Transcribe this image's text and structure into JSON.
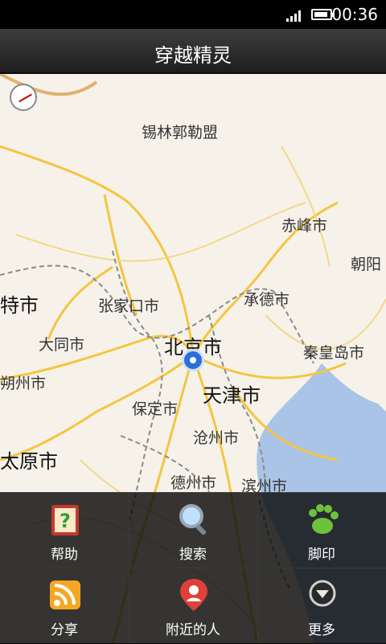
{
  "status_bar": {
    "time": "00:36"
  },
  "app": {
    "title": "穿越精灵"
  },
  "map": {
    "cities": [
      {
        "name": "锡林郭勒盟"
      },
      {
        "name": "赤峰市"
      },
      {
        "name": "朝阳"
      },
      {
        "name": "特市"
      },
      {
        "name": "张家口市"
      },
      {
        "name": "承德市"
      },
      {
        "name": "大同市"
      },
      {
        "name": "北京市"
      },
      {
        "name": "秦皇岛市"
      },
      {
        "name": "朔州市"
      },
      {
        "name": "天津市"
      },
      {
        "name": "保定市"
      },
      {
        "name": "沧州市"
      },
      {
        "name": "太原市"
      },
      {
        "name": "德州市"
      },
      {
        "name": "滨州市"
      }
    ]
  },
  "menu": {
    "items": [
      {
        "label": "帮助",
        "icon": "help-icon"
      },
      {
        "label": "搜索",
        "icon": "search-icon"
      },
      {
        "label": "脚印",
        "icon": "footprint-icon"
      },
      {
        "label": "分享",
        "icon": "rss-share-icon"
      },
      {
        "label": "附近的人",
        "icon": "nearby-people-icon"
      },
      {
        "label": "更多",
        "icon": "more-icon"
      }
    ]
  }
}
